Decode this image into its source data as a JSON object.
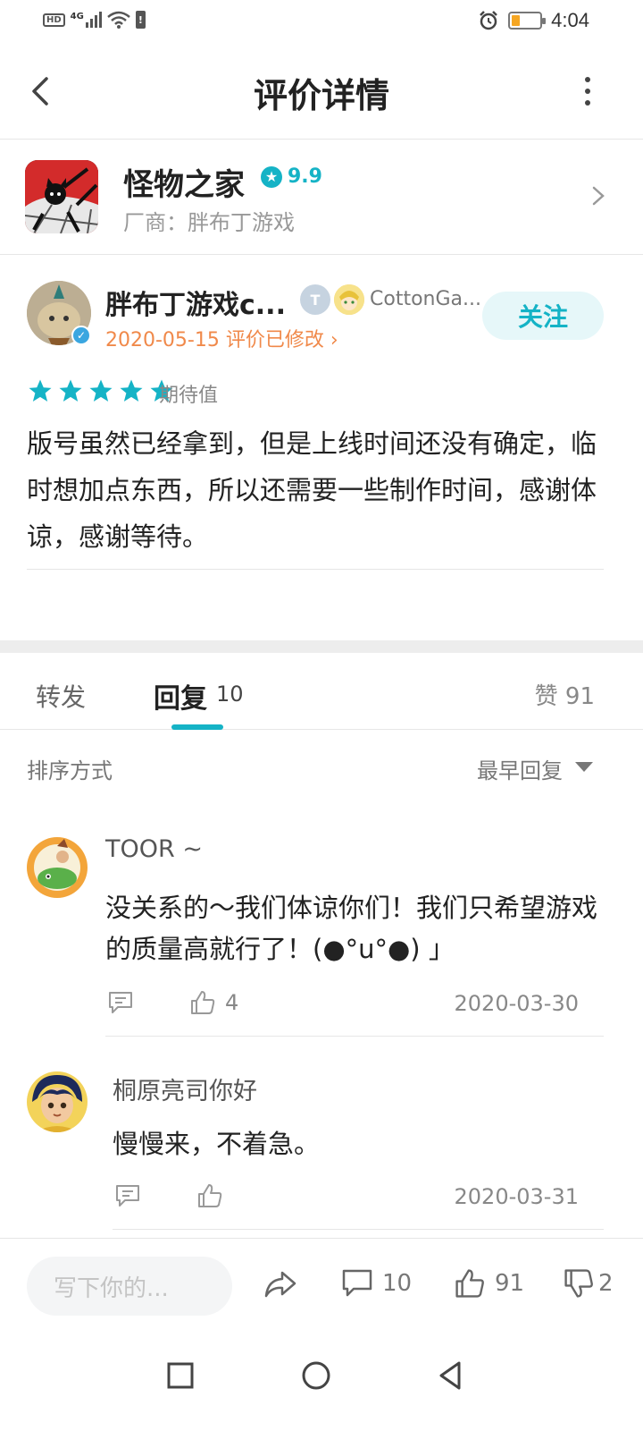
{
  "status": {
    "left_icons": [
      "hd-icon",
      "4g-signal-icon",
      "wifi-icon",
      "alert-icon"
    ],
    "hd": "HD",
    "network": "4G",
    "time": "4:04"
  },
  "header": {
    "title": "评价详情"
  },
  "game": {
    "name": "怪物之家",
    "score": "9.9",
    "vendor": "厂商：胖布丁游戏"
  },
  "review": {
    "author": "胖布丁游戏c...",
    "badge_t": "T",
    "badge_name": "CottonGa...",
    "date_line": "2020-05-15 评价已修改",
    "follow_label": "关注",
    "rating": 5,
    "rating_label": "期待值",
    "text": "版号虽然已经拿到，但是上线时间还没有确定，临时想加点东西，所以还需要一些制作时间，感谢体谅，感谢等待。"
  },
  "tabs": {
    "repost": "转发",
    "reply": "回复",
    "reply_count": "10",
    "likes": "赞 91"
  },
  "sort": {
    "label": "排序方式",
    "value": "最早回复"
  },
  "comments": [
    {
      "user": "TOOR ~",
      "text": "没关系的～我们体谅你们！我们只希望游戏的质量高就行了！(●°u°●) 」",
      "likes": "4",
      "date": "2020-03-30"
    },
    {
      "user": "桐原亮司你好",
      "text": "慢慢来，不着急。",
      "likes": "",
      "date": "2020-03-31"
    }
  ],
  "bottom": {
    "placeholder": "写下你的...",
    "comments": "10",
    "likes": "91",
    "dislikes": "2"
  },
  "colors": {
    "accent": "#15b3c6",
    "date_orange": "#f0894a"
  }
}
